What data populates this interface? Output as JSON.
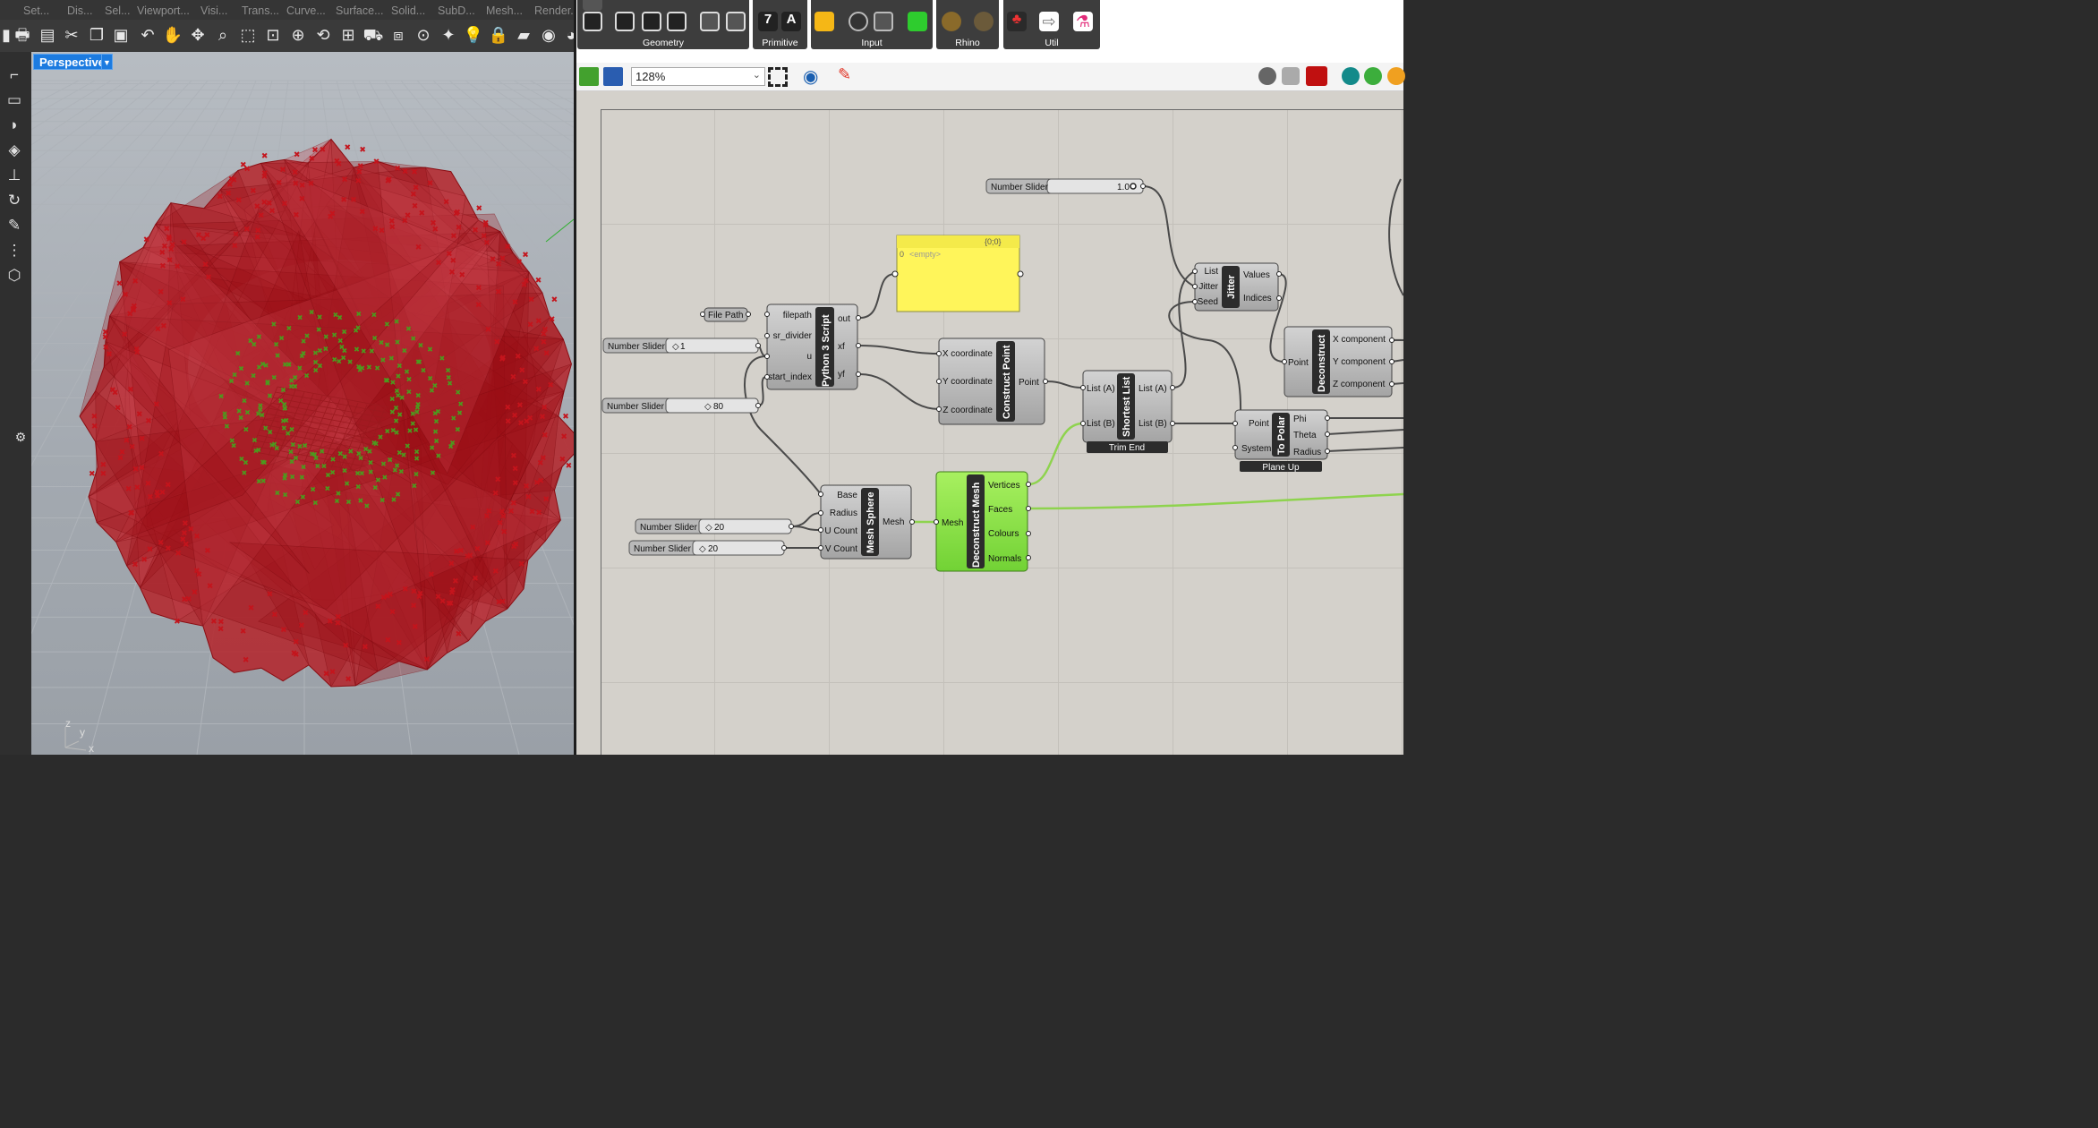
{
  "rhino": {
    "menu": [
      "Set...",
      "Dis...",
      "Sel...",
      "Viewport...",
      "Visi...",
      "Trans...",
      "Curve...",
      "Surface...",
      "Solid...",
      "SubD...",
      "Mesh...",
      "Render..."
    ],
    "viewport_name": "Perspective",
    "axis_labels": {
      "z": "z",
      "y": "y",
      "x": "x"
    }
  },
  "grasshopper": {
    "ribbon_groups": [
      "Geometry",
      "Primitive",
      "Input",
      "Rhino",
      "Util"
    ],
    "zoom": "128%",
    "colors": {
      "canvas": "#d4d1cb",
      "component": "#b3b3b3",
      "selected_component": "#8ee250",
      "panel": "#fff55a",
      "wire": "#4a4a4a",
      "wire_selected": "#8ed34e"
    },
    "components": {
      "slider_top": {
        "label": "Number Slider",
        "value": "1.0"
      },
      "panel": {
        "path": "{0;0}",
        "index": "0",
        "content": "<empty>"
      },
      "file_path": {
        "label": "File Path"
      },
      "slider_1": {
        "label": "Number Slider",
        "value": "1"
      },
      "slider_80": {
        "label": "Number Slider",
        "value": "80"
      },
      "python": {
        "title": "Python 3 Script",
        "inputs": [
          "filepath",
          "sr_divider",
          "u",
          "start_index"
        ],
        "outputs": [
          "out",
          "xf",
          "yf"
        ]
      },
      "construct_point": {
        "title": "Construct Point",
        "inputs": [
          "X coordinate",
          "Y coordinate",
          "Z coordinate"
        ],
        "outputs": [
          "Point"
        ]
      },
      "shortest_list": {
        "title": "Shortest List",
        "inputs": [
          "List (A)",
          "List (B)"
        ],
        "outputs": [
          "List (A)",
          "List (B)"
        ],
        "footer": "Trim End"
      },
      "jitter": {
        "title": "Jitter",
        "inputs": [
          "List",
          "Jitter",
          "Seed"
        ],
        "outputs": [
          "Values",
          "Indices"
        ]
      },
      "deconstruct": {
        "title": "Deconstruct",
        "inputs": [
          "Point"
        ],
        "outputs": [
          "X component",
          "Y component",
          "Z component"
        ]
      },
      "to_polar": {
        "title": "To Polar",
        "inputs": [
          "Point",
          "System"
        ],
        "outputs": [
          "Phi",
          "Theta",
          "Radius"
        ],
        "footer": "Plane Up"
      },
      "mesh_sphere": {
        "title": "Mesh Sphere",
        "inputs": [
          "Base",
          "Radius",
          "U Count",
          "V Count"
        ],
        "outputs": [
          "Mesh"
        ]
      },
      "slider_u": {
        "label": "Number Slider",
        "value": "20"
      },
      "slider_v": {
        "label": "Number Slider",
        "value": "20"
      },
      "deconstruct_mesh": {
        "title": "Deconstruct Mesh",
        "inputs": [
          "Mesh"
        ],
        "outputs": [
          "Vertices",
          "Faces",
          "Colours",
          "Normals"
        ]
      }
    }
  }
}
